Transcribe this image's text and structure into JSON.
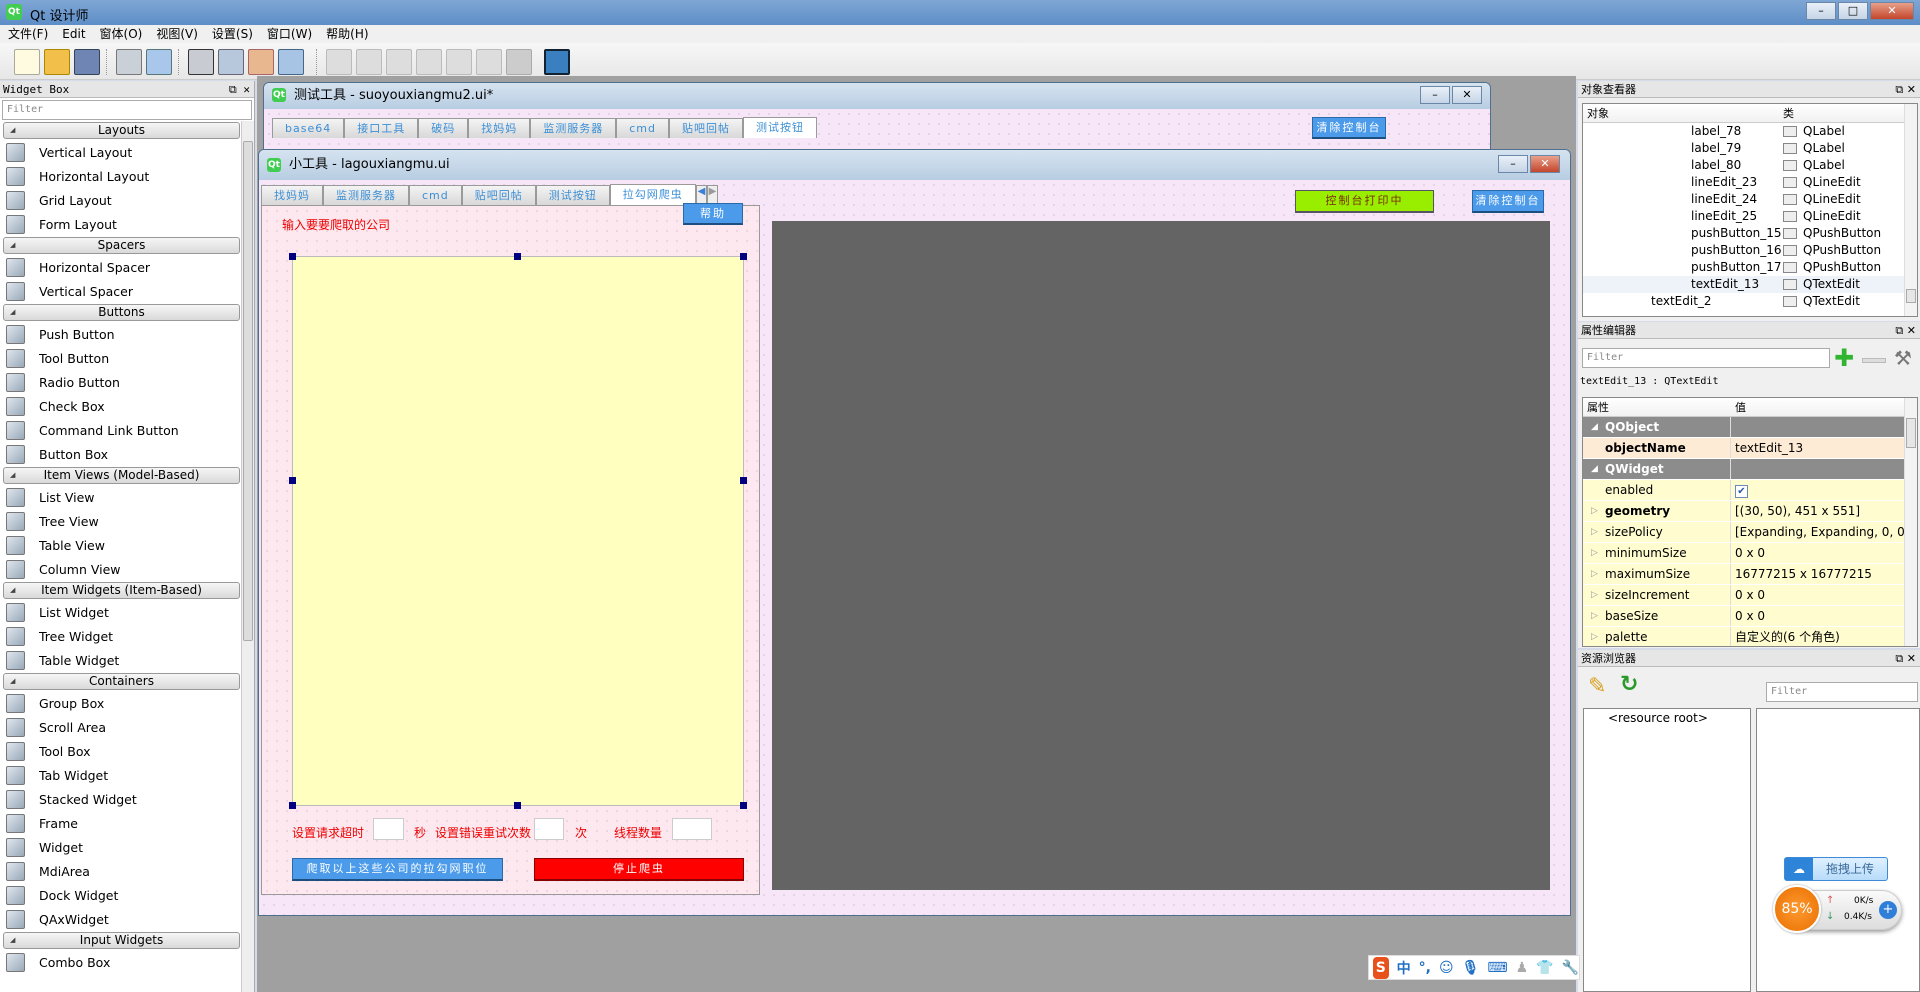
{
  "app": {
    "title": "Qt 设计师"
  },
  "menu": [
    "文件(F)",
    "Edit",
    "窗体(O)",
    "视图(V)",
    "设置(S)",
    "窗口(W)",
    "帮助(H)"
  ],
  "widget_box": {
    "title": "Widget Box",
    "filter_placeholder": "Filter",
    "sections": [
      {
        "label": "Layouts",
        "items": [
          "Vertical Layout",
          "Horizontal Layout",
          "Grid Layout",
          "Form Layout"
        ]
      },
      {
        "label": "Spacers",
        "items": [
          "Horizontal Spacer",
          "Vertical Spacer"
        ]
      },
      {
        "label": "Buttons",
        "items": [
          "Push Button",
          "Tool Button",
          "Radio Button",
          "Check Box",
          "Command Link Button",
          "Button Box"
        ]
      },
      {
        "label": "Item Views (Model-Based)",
        "items": [
          "List View",
          "Tree View",
          "Table View",
          "Column View"
        ]
      },
      {
        "label": "Item Widgets (Item-Based)",
        "items": [
          "List Widget",
          "Tree Widget",
          "Table Widget"
        ]
      },
      {
        "label": "Containers",
        "items": [
          "Group Box",
          "Scroll Area",
          "Tool Box",
          "Tab Widget",
          "Stacked Widget",
          "Frame",
          "Widget",
          "MdiArea",
          "Dock Widget",
          "QAxWidget"
        ]
      },
      {
        "label": "Input Widgets",
        "items": [
          "Combo Box"
        ]
      }
    ]
  },
  "window1": {
    "title": "测试工具 - suoyouxiangmu2.ui*",
    "tabs": [
      "base64",
      "接口工具",
      "破码",
      "找妈妈",
      "监测服务器",
      "cmd",
      "贴吧回帖",
      "测试按钮"
    ],
    "active_tab": 7,
    "clear_button": "清除控制台"
  },
  "window2": {
    "title": "小工具 - lagouxiangmu.ui",
    "tabs": [
      "找妈妈",
      "监测服务器",
      "cmd",
      "贴吧回帖",
      "测试按钮",
      "拉勾网爬虫"
    ],
    "active_tab": 5,
    "company_label": "输入要要爬取的公司",
    "help_button": "帮助",
    "timeout_label": "设置请求超时",
    "seconds_unit": "秒",
    "retry_label": "设置错误重试次数",
    "times_unit": "次",
    "threads_label": "线程数量",
    "crawl_button": "爬取以上这些公司的拉勾网职位",
    "stop_button": "停止爬虫",
    "console_status_button": "控制台打印中",
    "clear_button": "清除控制台"
  },
  "object_inspector": {
    "title": "对象查看器",
    "col_object": "对象",
    "col_class": "类",
    "rows": [
      {
        "name": "label_78",
        "cls": "QLabel",
        "icon": "label-icon"
      },
      {
        "name": "label_79",
        "cls": "QLabel",
        "icon": "label-icon"
      },
      {
        "name": "label_80",
        "cls": "QLabel",
        "icon": "label-icon"
      },
      {
        "name": "lineEdit_23",
        "cls": "QLineEdit",
        "icon": "lineedit-icon"
      },
      {
        "name": "lineEdit_24",
        "cls": "QLineEdit",
        "icon": "lineedit-icon"
      },
      {
        "name": "lineEdit_25",
        "cls": "QLineEdit",
        "icon": "lineedit-icon"
      },
      {
        "name": "pushButton_15",
        "cls": "QPushButton",
        "icon": "pushbutton-icon"
      },
      {
        "name": "pushButton_16",
        "cls": "QPushButton",
        "icon": "pushbutton-icon"
      },
      {
        "name": "pushButton_17",
        "cls": "QPushButton",
        "icon": "pushbutton-icon"
      },
      {
        "name": "textEdit_13",
        "cls": "QTextEdit",
        "icon": "textedit-icon"
      },
      {
        "name": "textEdit_2",
        "cls": "QTextEdit",
        "icon": "textedit-icon"
      }
    ]
  },
  "property_editor": {
    "title": "属性编辑器",
    "filter_placeholder": "Filter",
    "current": "textEdit_13 : QTextEdit",
    "col_property": "属性",
    "col_value": "值",
    "rows": [
      {
        "k": "QObject",
        "v": "",
        "type": "group"
      },
      {
        "k": "objectName",
        "v": "textEdit_13",
        "type": "bold-orange"
      },
      {
        "k": "QWidget",
        "v": "",
        "type": "group"
      },
      {
        "k": "enabled",
        "v": "✔",
        "type": "check"
      },
      {
        "k": "geometry",
        "v": "[(30, 50), 451 x 551]",
        "type": "bold"
      },
      {
        "k": "sizePolicy",
        "v": "[Expanding, Expanding, 0, 0]",
        "type": "normal"
      },
      {
        "k": "minimumSize",
        "v": "0 x 0",
        "type": "normal"
      },
      {
        "k": "maximumSize",
        "v": "16777215 x 16777215",
        "type": "normal"
      },
      {
        "k": "sizeIncrement",
        "v": "0 x 0",
        "type": "normal"
      },
      {
        "k": "baseSize",
        "v": "0 x 0",
        "type": "normal"
      },
      {
        "k": "palette",
        "v": "自定义的(6 个角色)",
        "type": "normal"
      }
    ]
  },
  "resource_browser": {
    "title": "资源浏览器",
    "filter_placeholder": "Filter",
    "root": "<resource root>"
  },
  "baidu_widget": {
    "upload_label": "拖拽上传",
    "percent": "85%",
    "up_speed": "0K/s",
    "down_speed": "0.4K/s"
  },
  "ime": {
    "mode": "中",
    "punct": "°,"
  }
}
